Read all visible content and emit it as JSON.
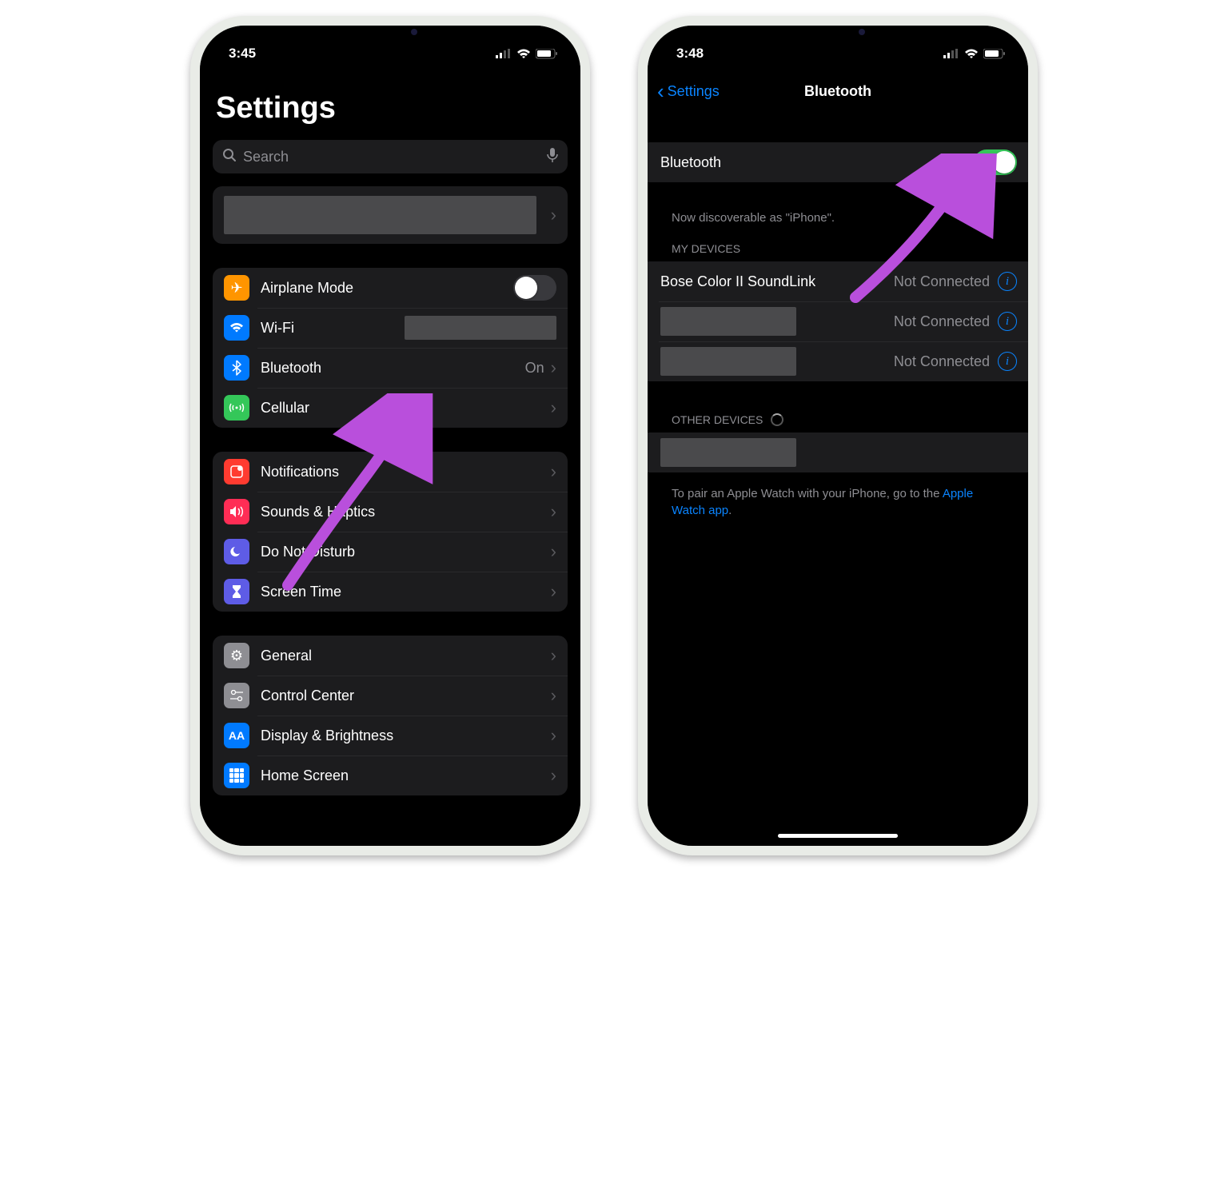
{
  "left": {
    "status": {
      "time": "3:45"
    },
    "title": "Settings",
    "search_placeholder": "Search",
    "rows": {
      "airplane": "Airplane Mode",
      "wifi": "Wi-Fi",
      "bluetooth": "Bluetooth",
      "bluetooth_value": "On",
      "cellular": "Cellular",
      "notifications": "Notifications",
      "sounds": "Sounds & Haptics",
      "dnd": "Do Not Disturb",
      "screentime": "Screen Time",
      "general": "General",
      "control": "Control Center",
      "display": "Display & Brightness",
      "home": "Home Screen"
    }
  },
  "right": {
    "status": {
      "time": "3:48"
    },
    "nav_back": "Settings",
    "nav_title": "Bluetooth",
    "toggle_label": "Bluetooth",
    "discoverable": "Now discoverable as \"iPhone\".",
    "my_devices_header": "MY DEVICES",
    "devices": [
      {
        "name": "Bose Color II SoundLink",
        "status": "Not Connected"
      },
      {
        "name": "",
        "status": "Not Connected"
      },
      {
        "name": "",
        "status": "Not Connected"
      }
    ],
    "other_devices_header": "OTHER DEVICES",
    "pair_footer_1": "To pair an Apple Watch with your iPhone, go to the ",
    "pair_footer_link": "Apple Watch app",
    "pair_footer_2": "."
  }
}
